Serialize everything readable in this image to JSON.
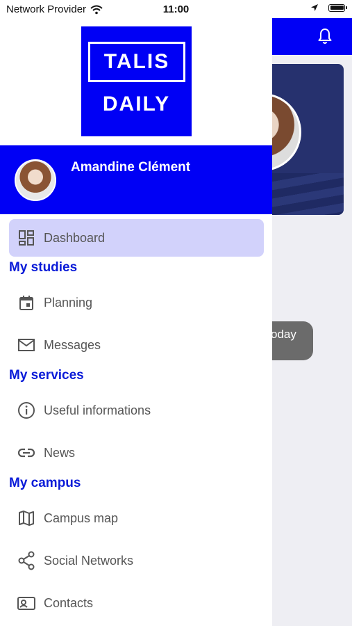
{
  "status_bar": {
    "carrier": "Network Provider",
    "time": "11:00"
  },
  "background": {
    "today_text": "oday"
  },
  "drawer": {
    "logo_line1": "TALIS",
    "logo_line2": "DAILY",
    "user_name": "Amandine Clément",
    "dashboard_label": "Dashboard",
    "sections": {
      "studies": "My studies",
      "services": "My services",
      "campus": "My campus"
    },
    "items": {
      "planning": "Planning",
      "messages": "Messages",
      "useful": "Useful informations",
      "news": "News",
      "campus_map": "Campus map",
      "social": "Social Networks",
      "contacts": "Contacts"
    }
  },
  "colors": {
    "brand_blue": "#0000f5",
    "section_blue": "#0a1bd8",
    "active_bg": "#d2d2fb"
  }
}
